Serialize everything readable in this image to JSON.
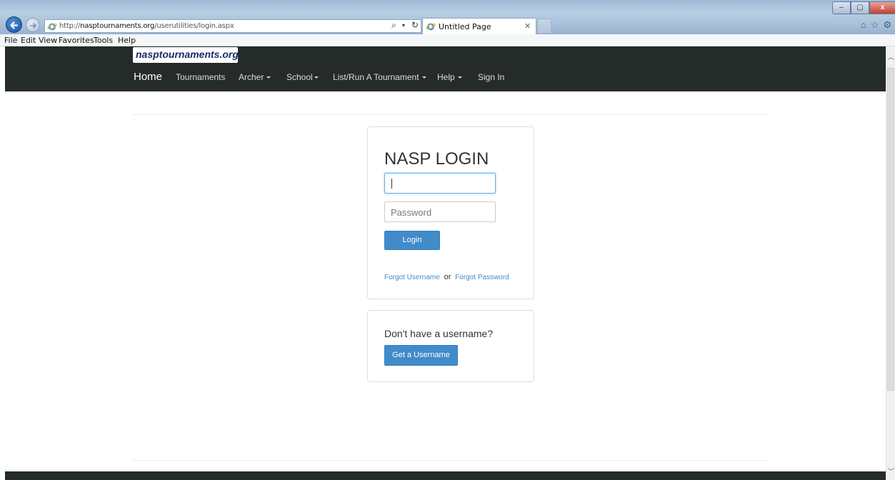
{
  "browser": {
    "url_prefix": "http://",
    "url_domain": "nasptournaments.org",
    "url_path": "/userutilities/login.aspx",
    "tab_title": "Untitled Page",
    "search_glyph": "⌕",
    "dropdown_glyph": "▾",
    "refresh_glyph": "↻",
    "tab_close_glyph": "✕",
    "minimize_glyph": "–",
    "maximize_glyph": "▢",
    "close_glyph": "x",
    "home_glyph": "⌂",
    "favorites_glyph": "☆",
    "tools_glyph": "⚙",
    "menu": [
      "File",
      "Edit",
      "View",
      "Favorites",
      "Tools",
      "Help"
    ]
  },
  "site": {
    "brand": "nasptournaments.org",
    "nav": {
      "home": "Home",
      "tournaments": "Tournaments",
      "archer": "Archer",
      "school": "School",
      "list_run": "List/Run A Tournament",
      "help": "Help",
      "sign_in": "Sign In"
    }
  },
  "login": {
    "title": "NASP LOGIN",
    "username_value": "",
    "password_placeholder": "Password",
    "login_button": "Login",
    "forgot_username": "Forgot Username",
    "or": "or",
    "forgot_password": "Forgot Password"
  },
  "signup": {
    "prompt": "Don't have a username?",
    "button": "Get a Username"
  },
  "colors": {
    "navbar_bg": "#252b28",
    "primary_button": "#428bca",
    "link": "#428bca",
    "brand_text": "#1a2a6c"
  }
}
